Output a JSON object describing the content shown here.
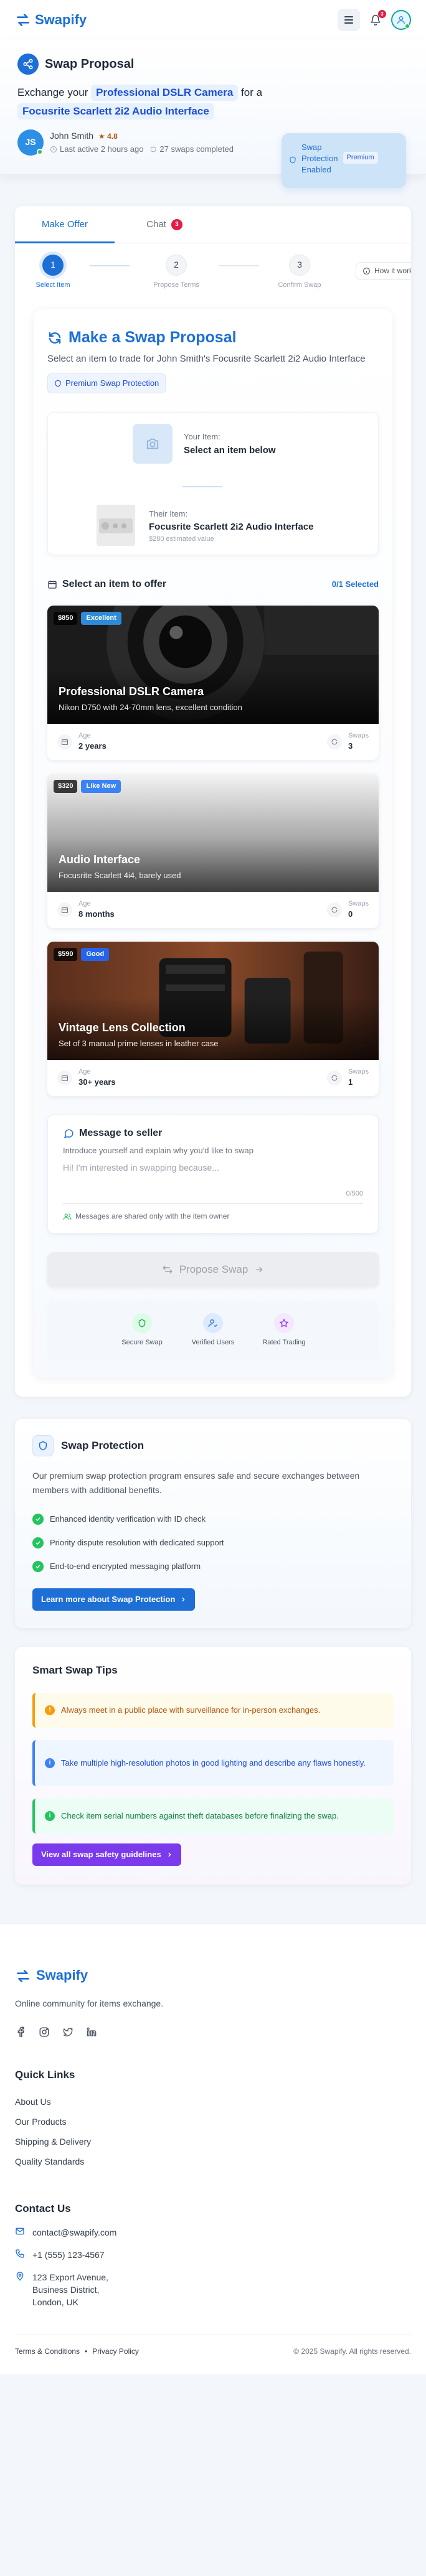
{
  "app": {
    "name": "Swapify",
    "notification_count": "3"
  },
  "header": {
    "title": "Swap Proposal",
    "exchange_prefix": "Exchange your",
    "your_item": "Professional DSLR Camera",
    "for_word": "for a",
    "their_item": "Focusrite Scarlett 2i2 Audio Interface",
    "owner": {
      "initials": "JS",
      "name": "John Smith",
      "rating": "4.8",
      "last_active": "Last active 2 hours ago",
      "swaps": "27 swaps completed"
    },
    "protection": {
      "line1": "Swap",
      "line2": "Protection",
      "line3": "Enabled",
      "chip": "Premium"
    }
  },
  "tabs": [
    {
      "label": "Make Offer"
    },
    {
      "label": "Chat",
      "badge": "3"
    }
  ],
  "steps": [
    {
      "num": "1",
      "label": "Select Item"
    },
    {
      "num": "2",
      "label": "Propose Terms"
    },
    {
      "num": "3",
      "label": "Confirm Swap"
    }
  ],
  "how_it_works": "How it works",
  "proposal": {
    "title": "Make a Swap Proposal",
    "subtitle": "Select an item to trade for John Smith's Focusrite Scarlett 2i2 Audio Interface",
    "premium_label": "Premium Swap Protection",
    "your_item_label": "Your Item:",
    "your_item_value": "Select an item below",
    "their_item_label": "Their Item:",
    "their_item_value": "Focusrite Scarlett 2i2 Audio Interface",
    "their_item_price": "$280 estimated value",
    "select_label": "Select an item to offer",
    "selected_count": "0/1 Selected"
  },
  "items": [
    {
      "price": "$850",
      "condition": "Excellent",
      "condition_color": "#2e8bd8",
      "title": "Professional DSLR Camera",
      "desc": "Nikon D750 with 24-70mm lens, excellent condition",
      "age_label": "Age",
      "age": "2 years",
      "swaps_label": "Swaps",
      "swaps": "3"
    },
    {
      "price": "$320",
      "condition": "Like New",
      "condition_color": "#3b82f6",
      "title": "Audio Interface",
      "desc": "Focusrite Scarlett 4i4, barely used",
      "age_label": "Age",
      "age": "8 months",
      "swaps_label": "Swaps",
      "swaps": "0"
    },
    {
      "price": "$590",
      "condition": "Good",
      "condition_color": "#2563eb",
      "title": "Vintage Lens Collection",
      "desc": "Set of 3 manual prime lenses in leather case",
      "age_label": "Age",
      "age": "30+ years",
      "swaps_label": "Swaps",
      "swaps": "1"
    }
  ],
  "message": {
    "title": "Message to seller",
    "subtitle": "Introduce yourself and explain why you'd like to swap",
    "placeholder": "Hi! I'm interested in swapping because...",
    "char_count": "0/500",
    "note": "Messages are shared only with the item owner"
  },
  "propose_button": "Propose Swap",
  "trust": [
    {
      "label": "Secure Swap"
    },
    {
      "label": "Verified Users"
    },
    {
      "label": "Rated Trading"
    }
  ],
  "protection_section": {
    "title": "Swap Protection",
    "description": "Our premium swap protection program ensures safe and secure exchanges between members with additional benefits.",
    "features": [
      "Enhanced identity verification with ID check",
      "Priority dispute resolution with dedicated support",
      "End-to-end encrypted messaging platform"
    ],
    "button": "Learn more about Swap Protection"
  },
  "tips": {
    "title": "Smart Swap Tips",
    "items": [
      "Always meet in a public place with surveillance for in-person exchanges.",
      "Take multiple high-resolution photos in good lighting and describe any flaws honestly.",
      "Check item serial numbers against theft databases before finalizing the swap."
    ],
    "button": "View all swap safety guidelines"
  },
  "footer": {
    "brand": "Swapify",
    "description": "Online community for items exchange.",
    "quick_links_title": "Quick Links",
    "quick_links": [
      "About Us",
      "Our Products",
      "Shipping & Delivery",
      "Quality Standards"
    ],
    "contact_title": "Contact Us",
    "email": "contact@swapify.com",
    "phone": "+1 (555) 123-4567",
    "address_line1": "123 Export Avenue,",
    "address_line2": "Business District,",
    "address_line3": "London, UK",
    "terms": "Terms & Conditions",
    "privacy": "Privacy Policy",
    "copyright": "© 2025 Swapify. All rights reserved."
  },
  "colors": {
    "primary": "#1d6fd6",
    "success": "#22c55e",
    "danger": "#e11d48",
    "purple": "#7c3aed"
  }
}
